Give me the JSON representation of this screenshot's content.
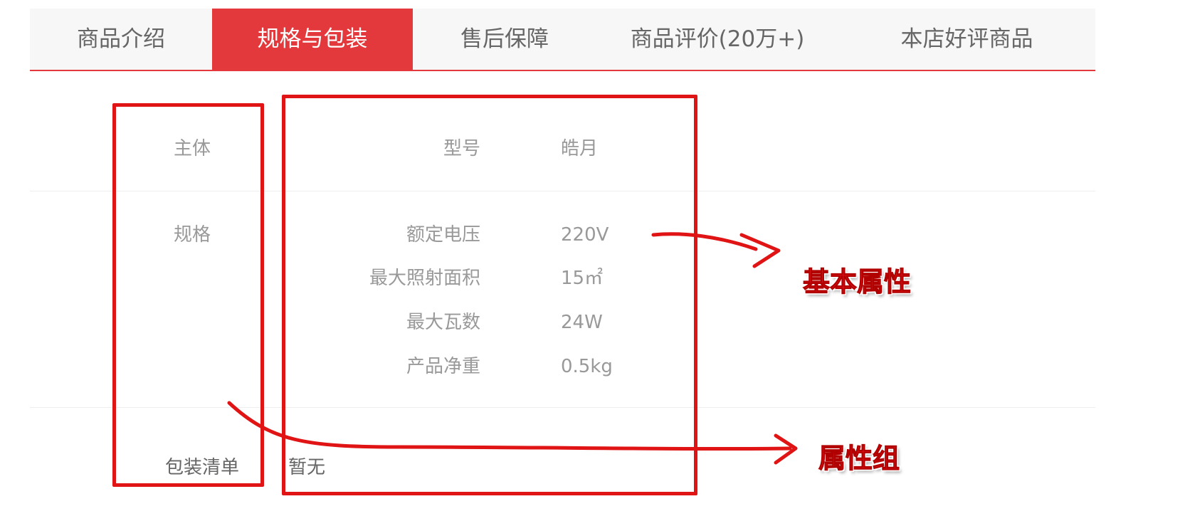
{
  "tabs": [
    {
      "label": "商品介绍",
      "active": false
    },
    {
      "label": "规格与包装",
      "active": true
    },
    {
      "label": "售后保障",
      "active": false
    },
    {
      "label": "商品评价(20万+)",
      "active": false
    },
    {
      "label": "本店好评商品",
      "active": false
    }
  ],
  "spec_groups": [
    {
      "group": "主体",
      "attributes": [
        {
          "name": "型号",
          "value": "皓月"
        }
      ]
    },
    {
      "group": "规格",
      "attributes": [
        {
          "name": "额定电压",
          "value": "220V"
        },
        {
          "name": "最大照射面积",
          "value": "15㎡"
        },
        {
          "name": "最大瓦数",
          "value": "24W"
        },
        {
          "name": "产品净重",
          "value": "0.5kg"
        }
      ]
    }
  ],
  "packing_list": {
    "label": "包装清单",
    "value": "暂无"
  },
  "annotations": {
    "basic_attributes": "基本属性",
    "attribute_group": "属性组"
  },
  "colors": {
    "accent": "#e4393c",
    "annotation_red": "#e01414",
    "tab_bg": "#f7f7f7",
    "muted_text": "#999999"
  }
}
